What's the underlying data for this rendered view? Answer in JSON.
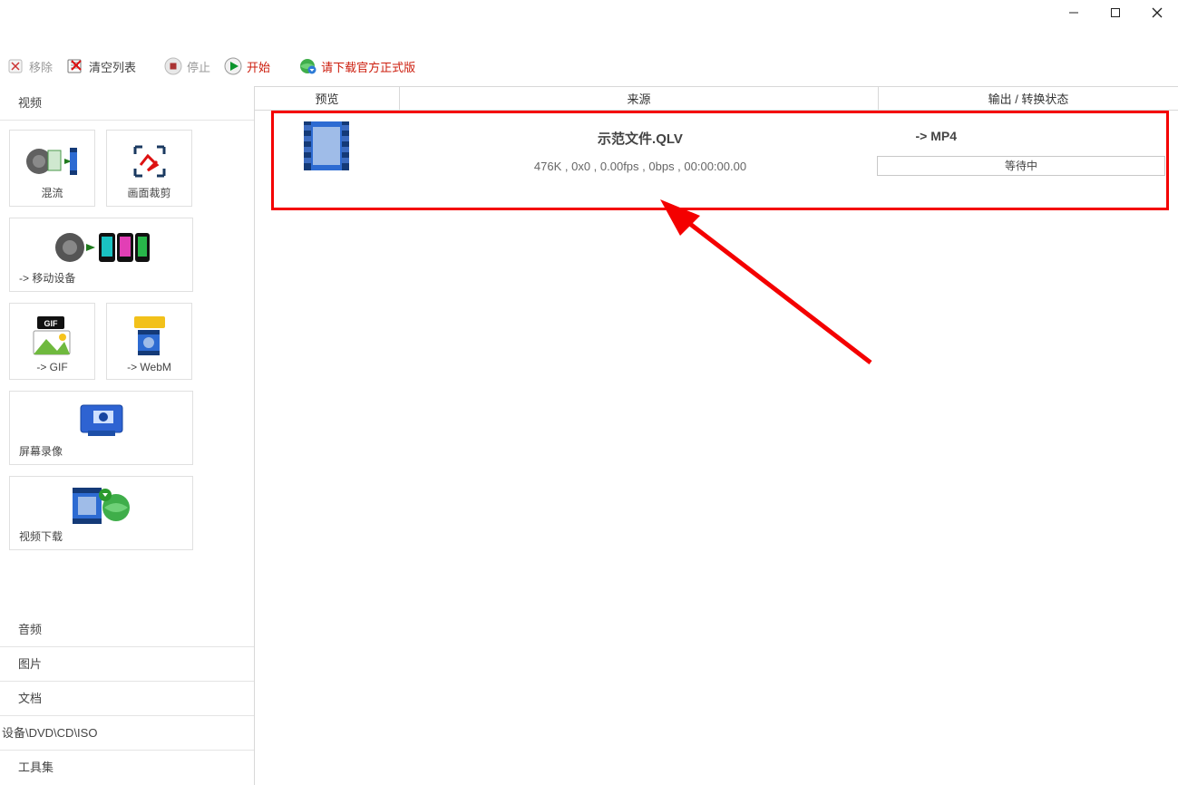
{
  "window": {
    "minimize": "—",
    "maximize": "□",
    "close": "×"
  },
  "toolbar": {
    "remove_label": "移除",
    "clear_label": "清空列表",
    "stop_label": "停止",
    "start_label": "开始",
    "download_link": "请下载官方正式版"
  },
  "sidebar": {
    "cat_video": "视频",
    "tiles": {
      "mix": "混流",
      "crop": "画面裁剪",
      "mobile": "-> 移动设备",
      "gif": "-> GIF",
      "webm": "-> WebM",
      "screen_record": "屏幕录像",
      "video_download": "视频下载"
    },
    "gif_badge": "GIF",
    "cat_audio": "音频",
    "cat_image": "图片",
    "cat_doc": "文档",
    "cat_disc": "设备\\DVD\\CD\\ISO",
    "cat_tools": "工具集"
  },
  "main": {
    "header": {
      "preview": "预览",
      "source": "来源",
      "output": "输出 / 转换状态"
    },
    "row": {
      "filename": "示范文件.QLV",
      "meta": "476K , 0x0 , 0.00fps , 0bps , 00:00:00.00",
      "out_label": "-> MP4",
      "status": "等待中"
    }
  }
}
